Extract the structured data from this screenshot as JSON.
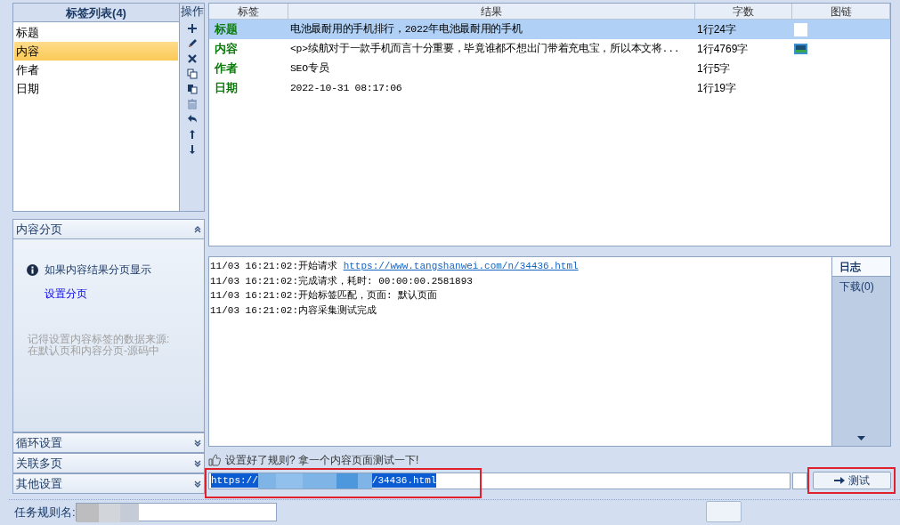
{
  "tag_list": {
    "title": "标签列表(4)",
    "items": [
      {
        "label": "标题",
        "selected": false
      },
      {
        "label": "内容",
        "selected": true
      },
      {
        "label": "作者",
        "selected": false
      },
      {
        "label": "日期",
        "selected": false
      }
    ]
  },
  "operations": {
    "title": "操作"
  },
  "result_table": {
    "columns": [
      "标签",
      "结果",
      "字数",
      "图链"
    ],
    "rows": [
      {
        "tag": "标题",
        "result": "电池最耐用的手机排行，2022年电池最耐用的手机",
        "count": "1行24字",
        "kind": "blank",
        "selected": true
      },
      {
        "tag": "内容",
        "result": "<p>续航对于一款手机而言十分重要，毕竟谁都不想出门带着充电宝，所以本文将...",
        "count": "1行4769字",
        "kind": "thumb",
        "selected": false
      },
      {
        "tag": "作者",
        "result": "SEO专员",
        "count": "1行5字",
        "selected": false
      },
      {
        "tag": "日期",
        "result": "2022-10-31 08:17:06",
        "count": "1行19字",
        "selected": false
      }
    ]
  },
  "sections": [
    {
      "title": "内容分页",
      "expanded": true,
      "info": "如果内容结果分页显示",
      "link": "设置分页",
      "note": "记得设置内容标签的数据来源:\n在默认页和内容分页-源码中"
    },
    {
      "title": "循环设置",
      "expanded": false
    },
    {
      "title": "关联多页",
      "expanded": false
    },
    {
      "title": "其他设置",
      "expanded": false
    }
  ],
  "log": [
    {
      "time": "11/03 16:21:02:",
      "message": "开始请求 ",
      "link": "https://www.tangshanwei.com/n/34436.html"
    },
    {
      "time": "11/03 16:21:02:",
      "message": "完成请求，耗时: 00:00:00.2581893"
    },
    {
      "time": "11/03 16:21:02:",
      "message": "开始标签匹配，页面: 默认页面"
    },
    {
      "time": "11/03 16:21:02:",
      "message": "内容采集测试完成"
    }
  ],
  "log_tabs": [
    {
      "label": "日志",
      "selected": true
    },
    {
      "label": "下载(0)",
      "selected": false
    }
  ],
  "hint": "设置好了规则? 拿一个内容页面测试一下!",
  "url_field": {
    "start": "https://",
    "end": "/34436.html"
  },
  "test_button": "测试",
  "rule_name": {
    "label": "任务规则名:"
  }
}
